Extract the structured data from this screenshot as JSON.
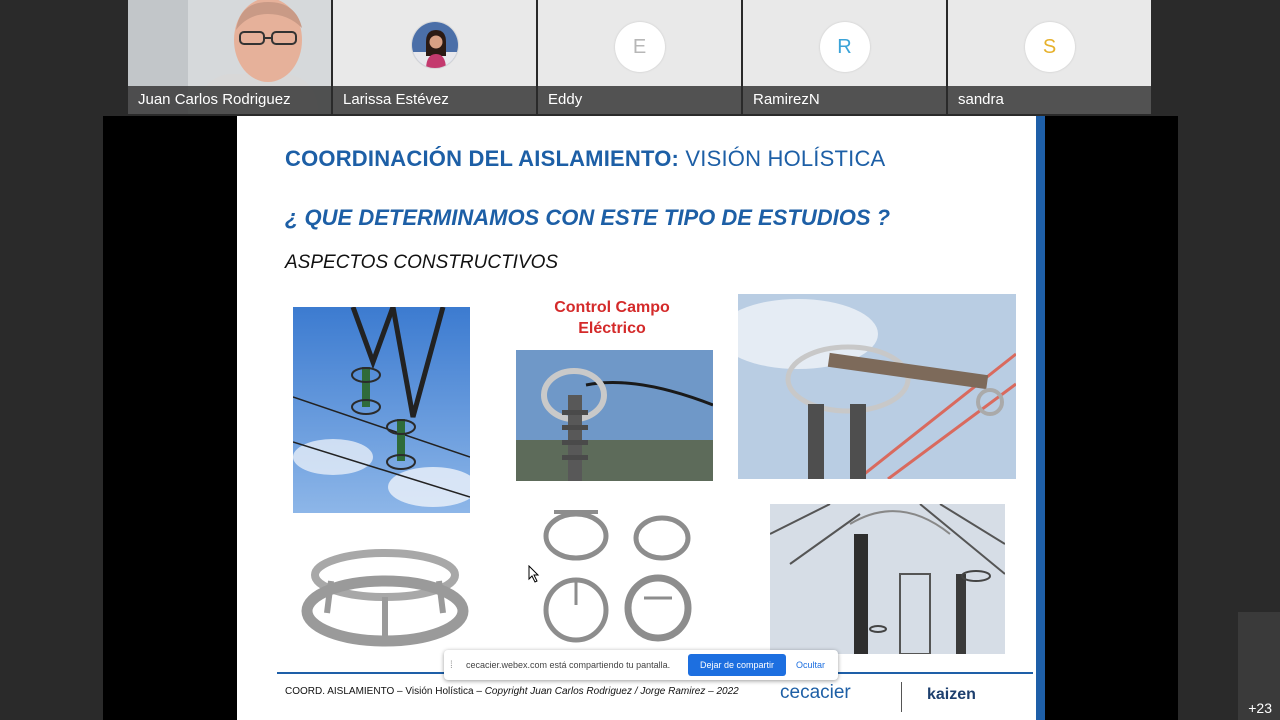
{
  "participants": [
    {
      "name": "Juan Carlos Rodriguez",
      "initial": "",
      "letter_color": ""
    },
    {
      "name": "Larissa Estévez",
      "initial": "",
      "letter_color": ""
    },
    {
      "name": "Eddy",
      "initial": "E",
      "letter_color": "#b7b7b7"
    },
    {
      "name": "RamirezN",
      "initial": "R",
      "letter_color": "#3aa3d8"
    },
    {
      "name": "sandra",
      "initial": "S",
      "letter_color": "#e6b12c"
    }
  ],
  "slide": {
    "title_bold": "COORDINACIÓN DEL AISLAMIENTO:",
    "title_light": "VISIÓN HOLÍSTICA",
    "question": "¿ QUE DETERMINAMOS CON ESTE TIPO DE ESTUDIOS ?",
    "subheading": "ASPECTOS CONSTRUCTIVOS",
    "control_label_line1": "Control Campo",
    "control_label_line2": "Eléctrico",
    "footer_main": "COORD. AISLAMIENTO – Visión Holística – ",
    "footer_italic": "Copyright Juan Carlos Rodriguez / Jorge Ramirez – 2022",
    "logo_left": "cecacier",
    "logo_right": "kaizen",
    "accent_color": "#1d5fa6",
    "label_color": "#d42a2a"
  },
  "share_notice": {
    "message": "cecacier.webex.com está compartiendo tu pantalla.",
    "stop_button": "Dejar de compartir",
    "hide_link": "Ocultar"
  },
  "more_participants": "+23",
  "icons": {
    "grip": "grip-icon",
    "cursor": "mouse-cursor-icon"
  }
}
